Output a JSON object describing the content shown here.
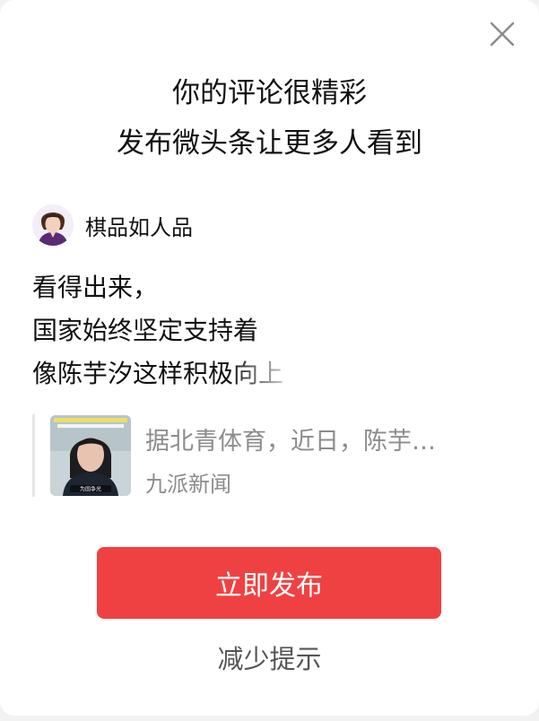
{
  "dialog": {
    "title_line1": "你的评论很精彩",
    "title_line2": "发布微头条让更多人看到",
    "close_icon": "close-icon"
  },
  "author": {
    "name": "棋品如人品",
    "avatar_icon": "avatar"
  },
  "comment": {
    "lines": [
      "看得出来，",
      "国家始终坚定支持着",
      "像陈芋汐这样积极向上"
    ]
  },
  "article": {
    "title": "据北青体育，近日，陈芋…",
    "source": "九派新闻",
    "thumbnail_caption": "为国争光"
  },
  "actions": {
    "publish_label": "立即发布",
    "reduce_label": "减少提示"
  },
  "colors": {
    "accent": "#f04142",
    "text_primary": "#111111",
    "text_secondary": "#8c8c8c"
  }
}
